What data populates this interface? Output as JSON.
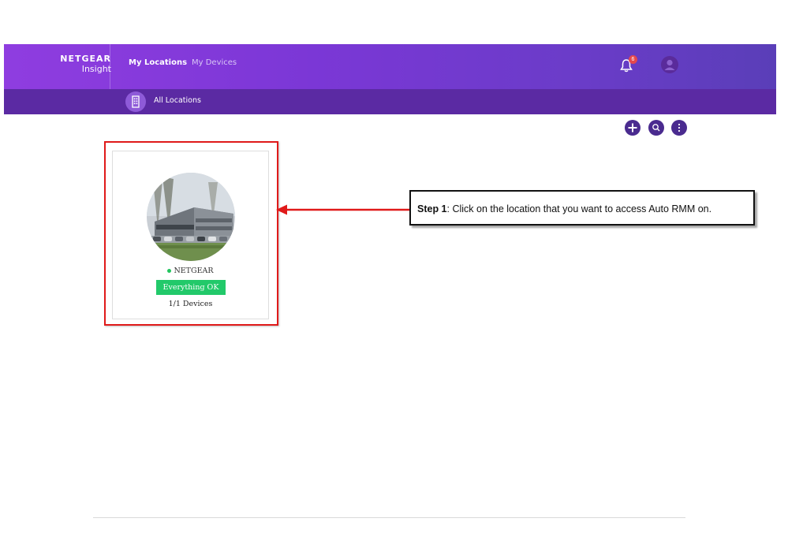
{
  "header": {
    "brand_name": "NETGEAR",
    "brand_sub": "Insight",
    "tabs": [
      {
        "label": "My Locations"
      },
      {
        "label": "My Devices"
      }
    ],
    "notification_count": "6",
    "colors": {
      "gradient_start": "#8f3de0",
      "gradient_end": "#5a3eb8"
    }
  },
  "subheader": {
    "label": "All Locations",
    "color": "#5b2aa3"
  },
  "actions": {
    "icons": [
      "plus-icon",
      "search-icon",
      "more-vertical-icon"
    ]
  },
  "location_card": {
    "name": "NETGEAR",
    "status": "Everything OK",
    "devices": "1/1 Devices",
    "status_color": "#22c96a"
  },
  "callout": {
    "step_label": "Step 1",
    "text": ": Click on the location that you want to access Auto RMM on."
  },
  "annotation_color": "#e01a1a"
}
